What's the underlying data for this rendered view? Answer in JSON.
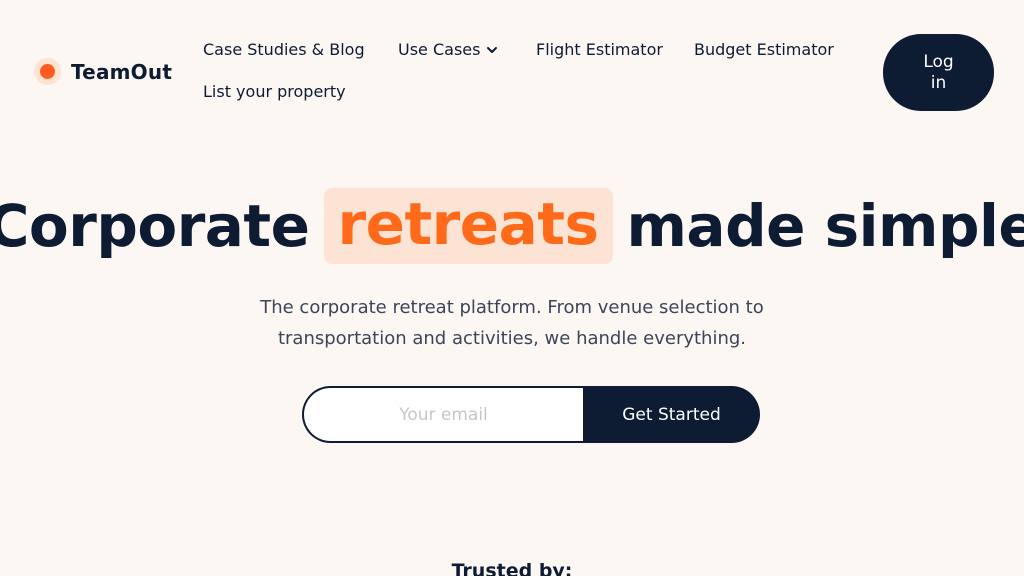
{
  "brand": {
    "name": "TeamOut",
    "accent": "#ff5a1f",
    "dark": "#0d1b33"
  },
  "nav": {
    "case_studies": "Case Studies & Blog",
    "use_cases": "Use Cases",
    "flight_estimator": "Flight Estimator",
    "budget_estimator": "Budget Estimator",
    "list_property": "List your property",
    "login": "Log in"
  },
  "hero": {
    "title_before": "Corporate",
    "title_highlight": "retreats",
    "title_after": "made simple",
    "subtitle_line1": "The corporate retreat platform. From venue selection to",
    "subtitle_line2": "transportation and activities, we handle everything."
  },
  "signup": {
    "email_placeholder": "Your email",
    "email_value": "",
    "button_label": "Get Started"
  },
  "trusted": {
    "label": "Trusted by:"
  },
  "icons": {
    "logo": "teamout-dot-logo",
    "use_cases_toggle": "chevron-down-icon"
  }
}
